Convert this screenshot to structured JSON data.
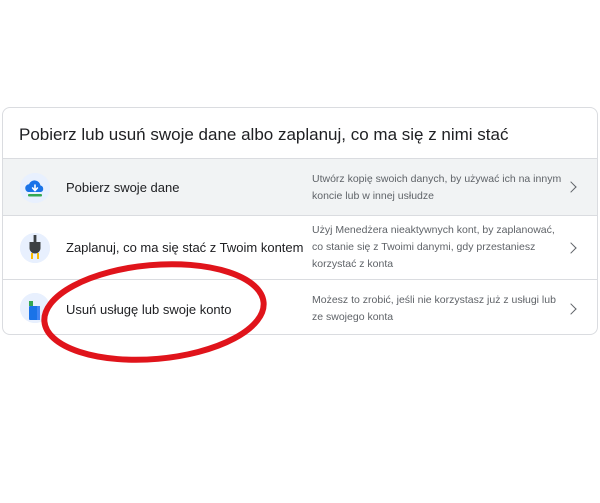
{
  "card": {
    "title": "Pobierz lub usuń swoje dane albo zaplanuj, co ma się z nimi stać",
    "rows": [
      {
        "icon": "cloud-download-icon",
        "label": "Pobierz swoje dane",
        "description": "Utwórz kopię swoich danych, by używać ich na innym koncie lub w innej usłudze"
      },
      {
        "icon": "power-plug-icon",
        "label": "Zaplanuj, co ma się stać z Twoim kontem",
        "description": "Użyj Menedżera nieaktywnych kont, by zaplanować, co stanie się z Twoimi danymi, gdy przestaniesz korzystać z konta"
      },
      {
        "icon": "delete-service-icon",
        "label": "Usuń usługę lub swoje konto",
        "description": "Możesz to zrobić, jeśli nie korzystasz już z usługi lub ze swojego konta"
      }
    ]
  },
  "colors": {
    "annotation_circle": "#e0141b",
    "highlight_row": "#f1f3f4",
    "google_blue": "#1a73e8",
    "google_green": "#34a853",
    "google_yellow": "#fbbc04"
  }
}
